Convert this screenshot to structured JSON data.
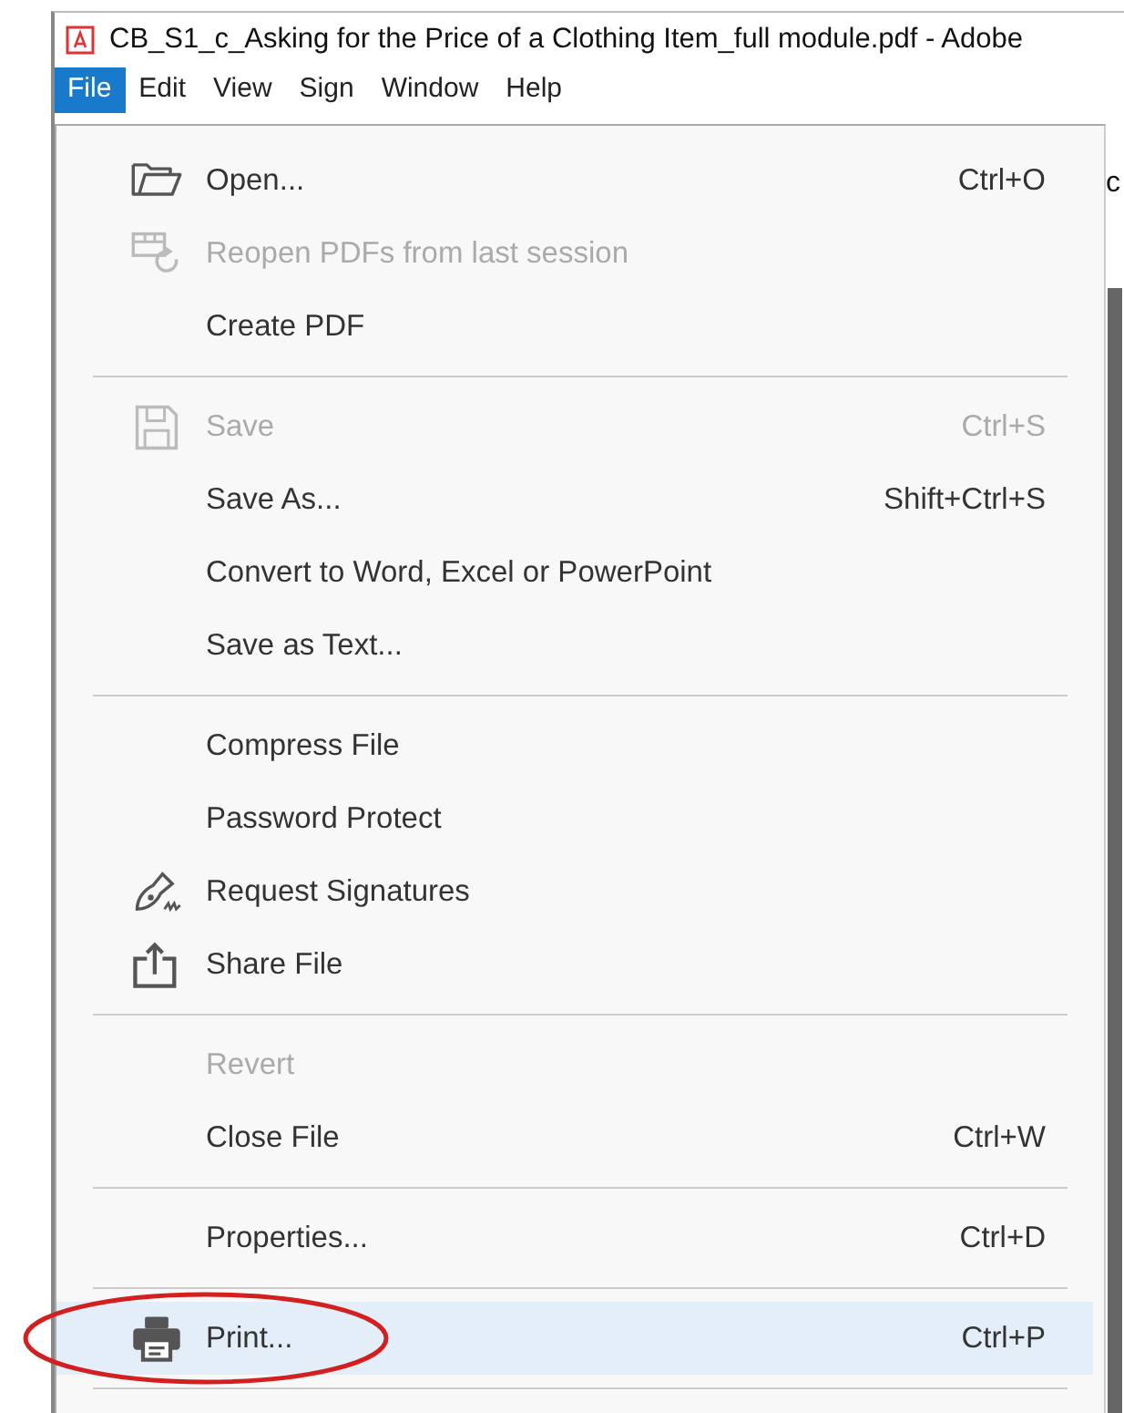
{
  "window": {
    "title": "CB_S1_c_Asking for the Price of a Clothing Item_full module.pdf - Adobe"
  },
  "menubar": [
    {
      "label": "File",
      "selected": true
    },
    {
      "label": "Edit",
      "selected": false
    },
    {
      "label": "View",
      "selected": false
    },
    {
      "label": "Sign",
      "selected": false
    },
    {
      "label": "Window",
      "selected": false
    },
    {
      "label": "Help",
      "selected": false
    }
  ],
  "document_text_fragment": "c",
  "file_menu": [
    {
      "kind": "item",
      "label": "Open...",
      "shortcut": "Ctrl+O",
      "disabled": false,
      "selected": false
    },
    {
      "kind": "item",
      "label": "Reopen PDFs from last session",
      "disabled": true,
      "selected": false
    },
    {
      "kind": "item",
      "label": "Create PDF",
      "disabled": false,
      "selected": false
    },
    {
      "kind": "separator"
    },
    {
      "kind": "item",
      "label": "Save",
      "shortcut": "Ctrl+S",
      "disabled": true,
      "selected": false
    },
    {
      "kind": "item",
      "label": "Save As...",
      "shortcut": "Shift+Ctrl+S",
      "disabled": false,
      "selected": false
    },
    {
      "kind": "item",
      "label": "Convert to Word, Excel or PowerPoint",
      "disabled": false,
      "selected": false
    },
    {
      "kind": "item",
      "label": "Save as Text...",
      "disabled": false,
      "selected": false
    },
    {
      "kind": "separator"
    },
    {
      "kind": "item",
      "label": "Compress File",
      "disabled": false,
      "selected": false
    },
    {
      "kind": "item",
      "label": "Password Protect",
      "disabled": false,
      "selected": false
    },
    {
      "kind": "item",
      "label": "Request Signatures",
      "disabled": false,
      "selected": false
    },
    {
      "kind": "item",
      "label": "Share File",
      "disabled": false,
      "selected": false
    },
    {
      "kind": "separator"
    },
    {
      "kind": "item",
      "label": "Revert",
      "disabled": true,
      "selected": false
    },
    {
      "kind": "item",
      "label": "Close File",
      "shortcut": "Ctrl+W",
      "disabled": false,
      "selected": false
    },
    {
      "kind": "separator"
    },
    {
      "kind": "item",
      "label": "Properties...",
      "shortcut": "Ctrl+D",
      "disabled": false,
      "selected": false
    },
    {
      "kind": "separator"
    },
    {
      "kind": "item",
      "label": "Print...",
      "shortcut": "Ctrl+P",
      "disabled": false,
      "selected": true,
      "circled": true
    },
    {
      "kind": "separator"
    }
  ]
}
